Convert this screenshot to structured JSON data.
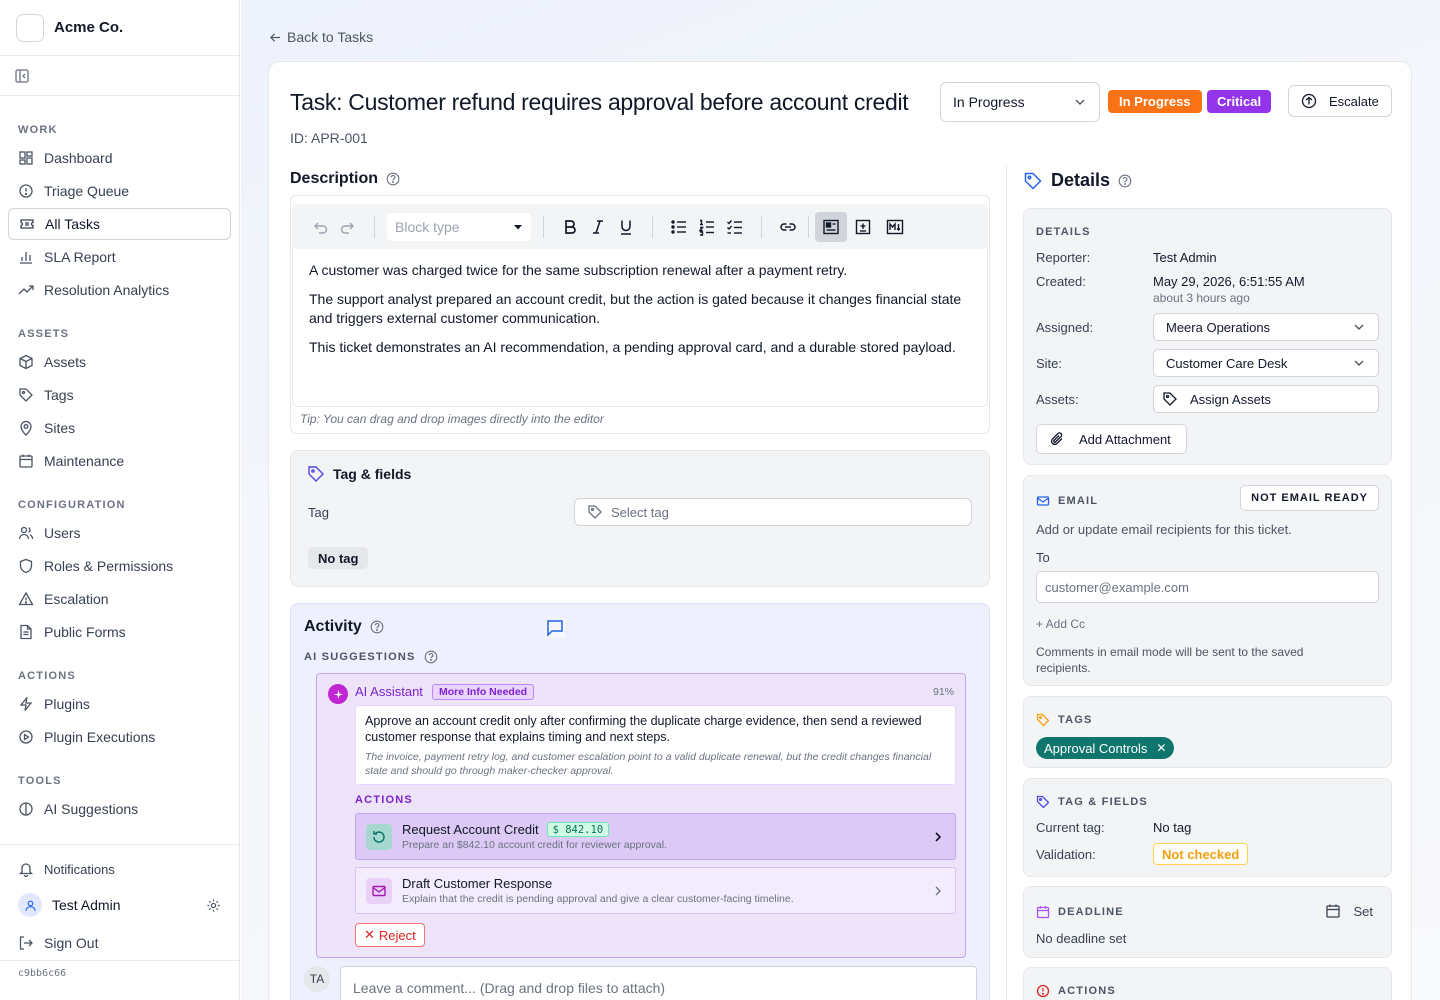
{
  "sidebar": {
    "brand": "Acme Co.",
    "sections": {
      "work": "WORK",
      "assets": "ASSETS",
      "configuration": "CONFIGURATION",
      "actions": "ACTIONS",
      "tools": "TOOLS"
    },
    "items": {
      "dashboard": "Dashboard",
      "triage": "Triage Queue",
      "all_tasks": "All Tasks",
      "sla": "SLA Report",
      "resolution": "Resolution Analytics",
      "assets": "Assets",
      "tags": "Tags",
      "sites": "Sites",
      "maintenance": "Maintenance",
      "users": "Users",
      "roles": "Roles & Permissions",
      "escalation": "Escalation",
      "public_forms": "Public Forms",
      "plugins": "Plugins",
      "plugin_executions": "Plugin Executions",
      "ai_suggestions": "AI Suggestions"
    },
    "notifications": "Notifications",
    "user_name": "Test Admin",
    "sign_out": "Sign Out",
    "version": "c9bb6c66"
  },
  "header": {
    "back": "Back to Tasks",
    "title": "Task: Customer refund requires approval before account credit",
    "id": "ID: APR-001",
    "status_select": "In Progress",
    "status_badge": "In Progress",
    "priority_badge": "Critical",
    "escalate": "Escalate"
  },
  "description": {
    "heading": "Description",
    "block_type_placeholder": "Block type",
    "paragraphs": [
      "A customer was charged twice for the same subscription renewal after a payment retry.",
      "The support analyst prepared an account credit, but the action is gated because it changes financial state and triggers external customer communication.",
      "This ticket demonstrates an AI recommendation, a pending approval card, and a durable stored payload."
    ],
    "tip": "Tip: You can drag and drop images directly into the editor"
  },
  "tag_fields": {
    "heading": "Tag & fields",
    "tag_label": "Tag",
    "select_placeholder": "Select tag",
    "current": "No tag"
  },
  "activity": {
    "heading": "Activity",
    "ai_label": "AI SUGGESTIONS",
    "assistant_name": "AI Assistant",
    "assistant_status": "More Info Needed",
    "confidence": "91%",
    "recommendation": "Approve an account credit only after confirming the duplicate charge evidence, then send a reviewed customer response that explains timing and next steps.",
    "reasoning": "The invoice, payment retry log, and customer escalation point to a valid duplicate renewal, but the credit changes financial state and should go through maker-checker approval.",
    "actions_label": "ACTIONS",
    "actions": [
      {
        "title": "Request Account Credit",
        "amount": "$ 842.10",
        "subtitle": "Prepare an $842.10 account credit for reviewer approval."
      },
      {
        "title": "Draft Customer Response",
        "subtitle": "Explain that the credit is pending approval and give a clear customer-facing timeline."
      }
    ],
    "reject": "Reject",
    "commenter_initials": "TA",
    "comment_placeholder": "Leave a comment... (Drag and drop files to attach)"
  },
  "details": {
    "heading": "Details",
    "section_label": "DETAILS",
    "reporter_key": "Reporter:",
    "reporter": "Test Admin",
    "created_key": "Created:",
    "created": "May 29, 2026, 6:51:55 AM",
    "created_relative": "about 3 hours ago",
    "assigned_key": "Assigned:",
    "assigned": "Meera Operations",
    "site_key": "Site:",
    "site": "Customer Care Desk",
    "assets_key": "Assets:",
    "assets_btn": "Assign Assets",
    "add_attachment": "Add Attachment"
  },
  "email": {
    "label": "EMAIL",
    "status": "NOT EMAIL READY",
    "desc": "Add or update email recipients for this ticket.",
    "to_label": "To",
    "to_placeholder": "customer@example.com",
    "add_cc": "+ Add Cc",
    "note": "Comments in email mode will be sent to the saved recipients."
  },
  "tags": {
    "label": "TAGS",
    "chip": "Approval Controls"
  },
  "tag_fields_panel": {
    "label": "TAG & FIELDS",
    "current_key": "Current tag:",
    "current": "No tag",
    "validation_key": "Validation:",
    "validation": "Not checked"
  },
  "deadline": {
    "label": "DEADLINE",
    "set": "Set",
    "value": "No deadline set"
  },
  "actions_panel": {
    "label": "ACTIONS"
  },
  "colors": {
    "accent": "#2563eb",
    "orange": "#f97316",
    "purple": "#9333ea",
    "teal": "#0f766e"
  }
}
